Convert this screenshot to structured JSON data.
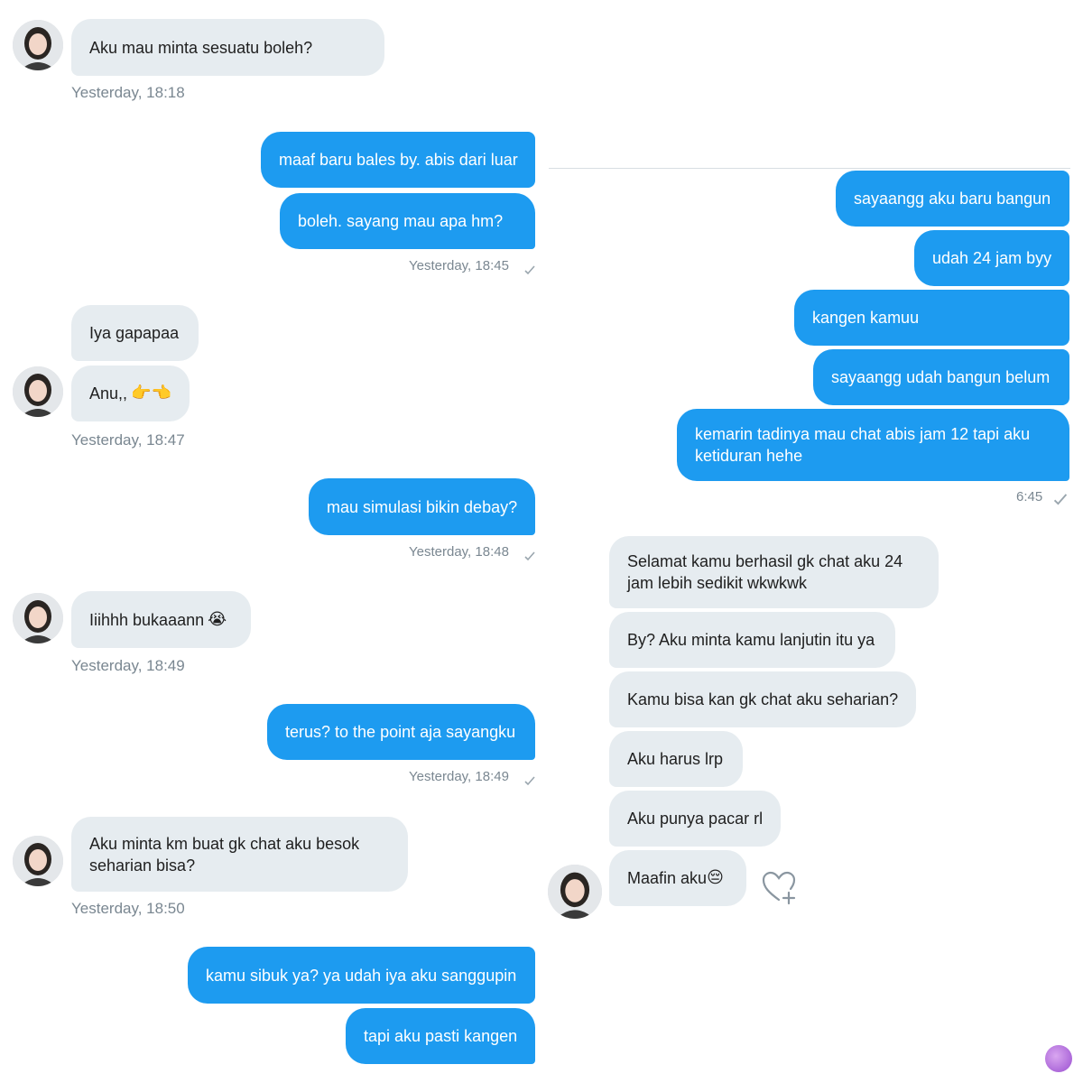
{
  "left_chat": {
    "messages": [
      {
        "text": "Aku mau minta sesuatu boleh?"
      },
      {
        "text": "maaf baru bales by. abis dari luar"
      },
      {
        "text": "boleh. sayang mau apa hm?"
      },
      {
        "text": "Iya gapapaa"
      },
      {
        "text": "Anu,,"
      },
      {
        "text": "mau simulasi bikin debay?"
      },
      {
        "text": "Iiihhh bukaaann"
      },
      {
        "text": "terus? to the point aja sayangku"
      },
      {
        "text": "Aku minta km buat gk chat aku besok seharian bisa?"
      },
      {
        "text": "kamu sibuk ya? ya udah iya aku sanggupin"
      },
      {
        "text": "tapi aku pasti kangen"
      }
    ],
    "timestamps": [
      "Yesterday, 18:18",
      "Yesterday, 18:45",
      "Yesterday, 18:47",
      "Yesterday, 18:48",
      "Yesterday, 18:49",
      "Yesterday, 18:49",
      "Yesterday, 18:50"
    ],
    "emojis": {
      "pointing": "👉👈",
      "crying": "😭"
    }
  },
  "right_chat": {
    "messages": [
      {
        "text": "sayaangg aku baru bangun"
      },
      {
        "text": "udah 24 jam byy"
      },
      {
        "text": "kangen kamuu"
      },
      {
        "text": "sayaangg udah bangun belum"
      },
      {
        "text": "kemarin tadinya mau chat abis jam 12 tapi aku ketiduran hehe"
      },
      {
        "text": "Selamat kamu berhasil gk chat aku 24 jam lebih sedikit wkwkwk"
      },
      {
        "text": "By? Aku minta kamu lanjutin itu ya"
      },
      {
        "text": "Kamu bisa kan gk chat aku seharian?"
      },
      {
        "text": "Aku harus lrp"
      },
      {
        "text": "Aku punya pacar rl"
      },
      {
        "text": "Maafin aku"
      }
    ],
    "timestamps": [
      "6:45"
    ],
    "emojis": {
      "sad": "😔"
    }
  },
  "colors": {
    "outgoing_bubble": "#1d9bf0",
    "incoming_bubble": "#e6ecf0",
    "timestamp": "#7a8791"
  },
  "icons": [
    "avatar",
    "read-check-icon",
    "heart-plus-icon",
    "watermark-logo"
  ]
}
